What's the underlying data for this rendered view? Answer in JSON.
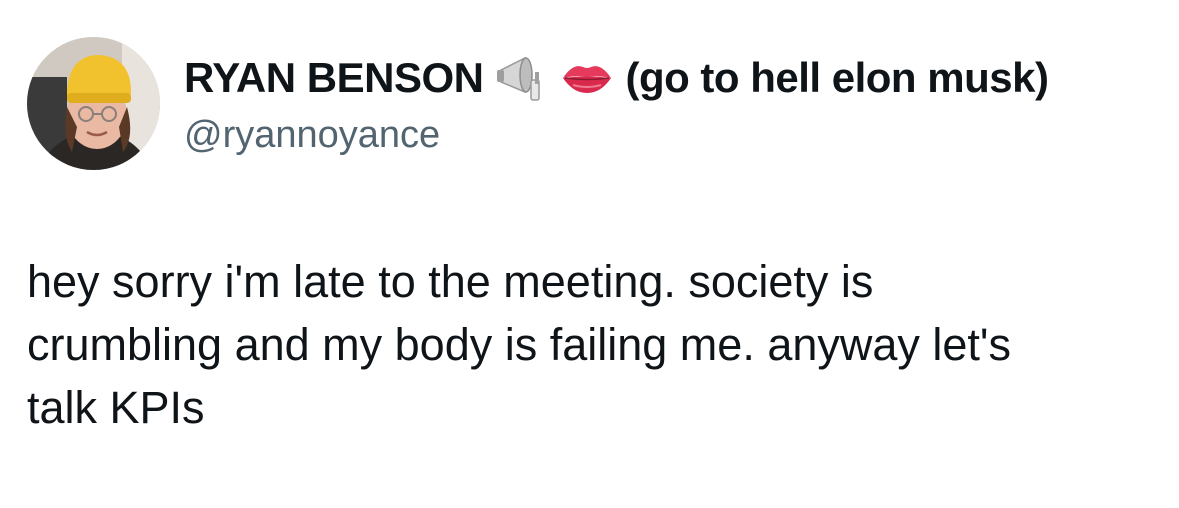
{
  "author": {
    "display_name": "RYAN BENSON",
    "emoji_1": "megaphone-icon",
    "emoji_2": "lips-icon",
    "name_suffix": "(go to hell elon musk)",
    "handle": "@ryannoyance"
  },
  "tweet": {
    "lines": [
      "hey sorry i'm late to the meeting. society is",
      "crumbling and my body is failing me. anyway let's",
      "talk KPIs"
    ]
  },
  "colors": {
    "text": "#0f1419",
    "secondary": "#536471",
    "background": "#ffffff"
  }
}
